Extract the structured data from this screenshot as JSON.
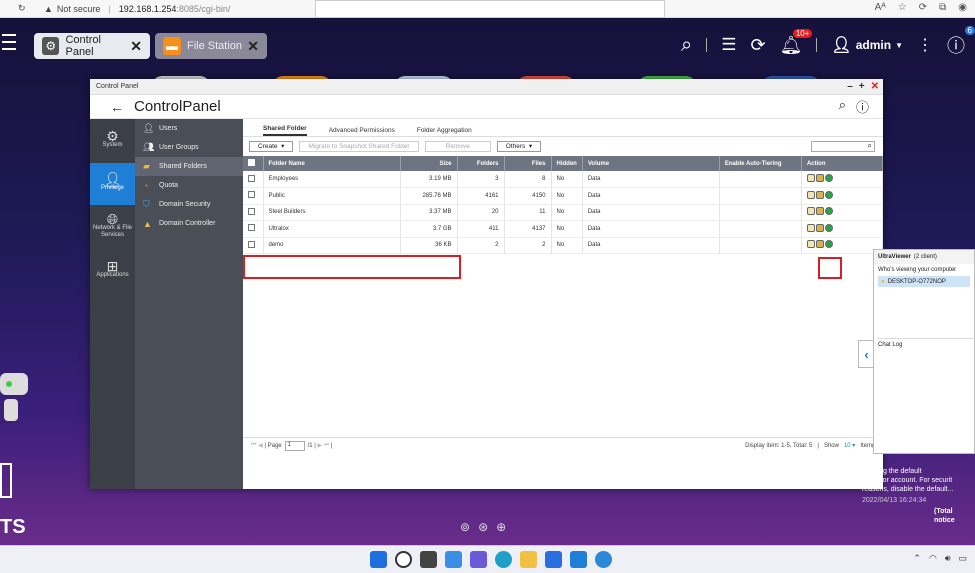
{
  "browser": {
    "security": "Not secure",
    "url_host": "192.168.1.254",
    "url_rest": ":8085/cgi-bin/"
  },
  "topbar": {
    "tabs": [
      {
        "label": "Control Panel"
      },
      {
        "label": "File Station"
      }
    ],
    "notification_count": "10+",
    "user": "admin",
    "info_count": "6"
  },
  "window": {
    "title": "Control Panel",
    "header": "ControlPanel"
  },
  "categories": [
    {
      "label": "System",
      "icon": "gear-icon"
    },
    {
      "label": "Privilege",
      "icon": "person-icon"
    },
    {
      "label": "Network & File Services",
      "icon": "globe-icon"
    },
    {
      "label": "Applications",
      "icon": "apps-icon"
    }
  ],
  "submenu": [
    {
      "label": "Users",
      "icon": "user-icon"
    },
    {
      "label": "User Groups",
      "icon": "users-icon"
    },
    {
      "label": "Shared Folders",
      "icon": "folder-icon"
    },
    {
      "label": "Quota",
      "icon": "pie-icon"
    },
    {
      "label": "Domain Security",
      "icon": "shield-icon"
    },
    {
      "label": "Domain Controller",
      "icon": "server-icon"
    }
  ],
  "content_tabs": [
    "Shared Folder",
    "Advanced Permissions",
    "Folder Aggregation"
  ],
  "toolbar": {
    "create": "Create",
    "migrate": "Migrate to Snapshot Shared Folder",
    "remove": "Remove",
    "others": "Others"
  },
  "table": {
    "headers": [
      "Folder Name",
      "Size",
      "Folders",
      "Files",
      "Hidden",
      "Volume",
      "Enable Auto-Tiering",
      "Action"
    ],
    "rows": [
      {
        "name": "Employees",
        "size": "3.19 MB",
        "folders": "3",
        "files": "8",
        "hidden": "No",
        "volume": "Data"
      },
      {
        "name": "Public",
        "size": "285.76 MB",
        "folders": "4161",
        "files": "4150",
        "hidden": "No",
        "volume": "Data"
      },
      {
        "name": "Steel Builders",
        "size": "3.37 MB",
        "folders": "20",
        "files": "11",
        "hidden": "No",
        "volume": "Data"
      },
      {
        "name": "Ultralox",
        "size": "3.7 GB",
        "folders": "411",
        "files": "4137",
        "hidden": "No",
        "volume": "Data"
      },
      {
        "name": "demo",
        "size": "36 KB",
        "folders": "2",
        "files": "2",
        "hidden": "No",
        "volume": "Data"
      }
    ]
  },
  "pager": {
    "page_label": "Page",
    "page": "1",
    "of": "/1",
    "display": "Display item: 1-5, Total: 5",
    "show_label": "Show",
    "show_value": "10",
    "items": "Item(s)"
  },
  "ultraviewer": {
    "title": "UltraViewer",
    "clients": "(2 client)",
    "viewing_label": "Who's viewing your computer",
    "client_name": "DESKTOP-O772NOP",
    "chat_label": "Chat Log"
  },
  "notice": {
    "line1": "re using the default",
    "line2": "inistrator account. For securit",
    "line3": "reasons, disable the default...",
    "time": "2022/04/13 16:24:34",
    "total": "(Total notice"
  },
  "desktop_text": "TS"
}
